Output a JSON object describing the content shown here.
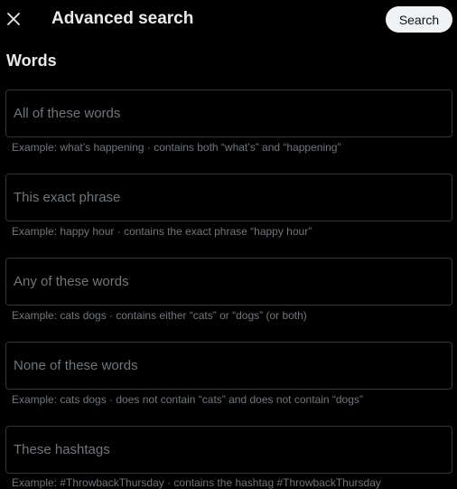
{
  "header": {
    "title": "Advanced search",
    "search_label": "Search",
    "close_icon": "close-icon"
  },
  "words": {
    "section_title": "Words",
    "fields": [
      {
        "placeholder": "All of these words",
        "value": "",
        "hint": "Example: what’s happening · contains both “what’s” and “happening”"
      },
      {
        "placeholder": "This exact phrase",
        "value": "",
        "hint": "Example: happy hour · contains the exact phrase “happy hour”"
      },
      {
        "placeholder": "Any of these words",
        "value": "",
        "hint": "Example: cats dogs · contains either “cats” or “dogs” (or both)"
      },
      {
        "placeholder": "None of these words",
        "value": "",
        "hint": "Example: cats dogs · does not contain “cats” and does not contain “dogs”"
      },
      {
        "placeholder": "These hashtags",
        "value": "",
        "hint": "Example: #ThrowbackThursday · contains the hashtag #ThrowbackThursday"
      }
    ]
  },
  "colors": {
    "background": "#000000",
    "text": "#e7e9ea",
    "secondary_text": "#71767b",
    "border": "#333639",
    "button_bg": "#eff3f4",
    "button_text": "#0f1419"
  }
}
